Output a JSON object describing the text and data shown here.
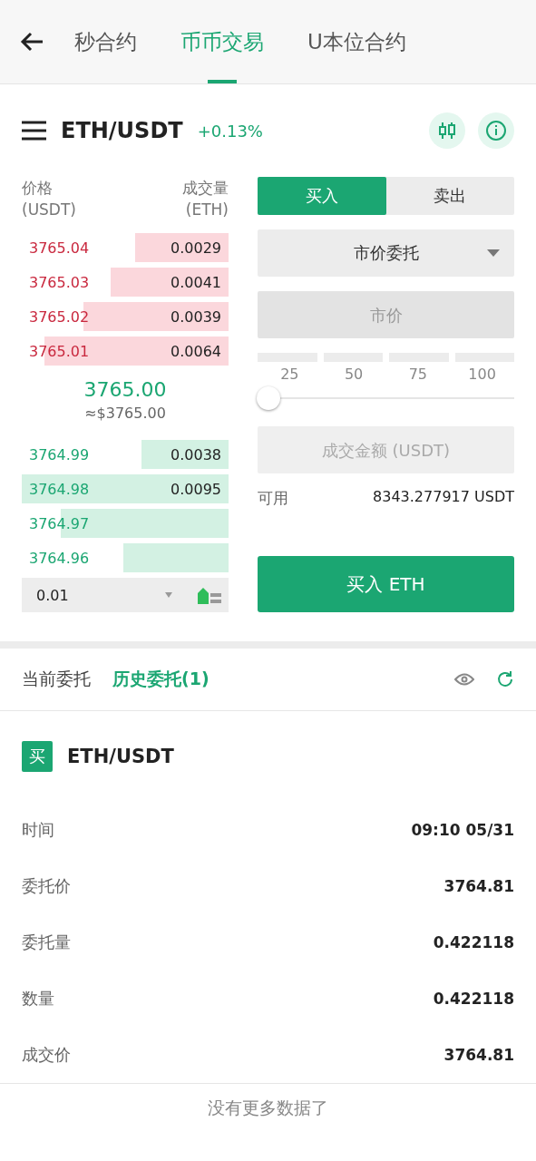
{
  "nav": {
    "tabs": [
      {
        "label": "秒合约",
        "selected": false
      },
      {
        "label": "币币交易",
        "selected": true
      },
      {
        "label": "U本位合约",
        "selected": false
      }
    ]
  },
  "pair": {
    "symbol": "ETH/USDT",
    "change": "+0.13%"
  },
  "book": {
    "price_header": "价格",
    "price_unit": "(USDT)",
    "volume_header": "成交量",
    "volume_unit": "(ETH)",
    "asks": [
      {
        "price": "3765.04",
        "volume": "0.0029"
      },
      {
        "price": "3765.03",
        "volume": "0.0041"
      },
      {
        "price": "3765.02",
        "volume": "0.0039"
      },
      {
        "price": "3765.01",
        "volume": "0.0064"
      }
    ],
    "last_price": "3765.00",
    "last_price_usd": "≈$3765.00",
    "bids": [
      {
        "price": "3764.99",
        "volume": "0.0038"
      },
      {
        "price": "3764.98",
        "volume": "0.0095"
      },
      {
        "price": "3764.97"
      },
      {
        "price": "3764.96"
      }
    ],
    "depth": "0.01"
  },
  "form": {
    "sides": [
      {
        "label": "买入",
        "selected": true
      },
      {
        "label": "卖出",
        "selected": false
      }
    ],
    "order_type": "市价委托",
    "price_placeholder": "市价",
    "percent_marks": [
      "25",
      "50",
      "75",
      "100"
    ],
    "level": 0,
    "amount_placeholder": "成交金额 (USDT)",
    "available_label": "可用",
    "available": "8343.277917 USDT",
    "submit": "买入 ETH"
  },
  "orders": {
    "tabs": [
      {
        "label": "当前委托",
        "selected": false
      },
      {
        "label": "历史委托(1)",
        "selected": true
      }
    ],
    "items": [
      {
        "side": "买",
        "symbol": "ETH/USDT",
        "fields": [
          {
            "label": "时间",
            "value": "09:10 05/31"
          },
          {
            "label": "委托价",
            "value": "3764.81"
          },
          {
            "label": "委托量",
            "value": "0.422118"
          },
          {
            "label": "数量",
            "value": "0.422118"
          },
          {
            "label": "成交价",
            "value": "3764.81"
          }
        ]
      }
    ],
    "footer": "没有更多数据了"
  }
}
